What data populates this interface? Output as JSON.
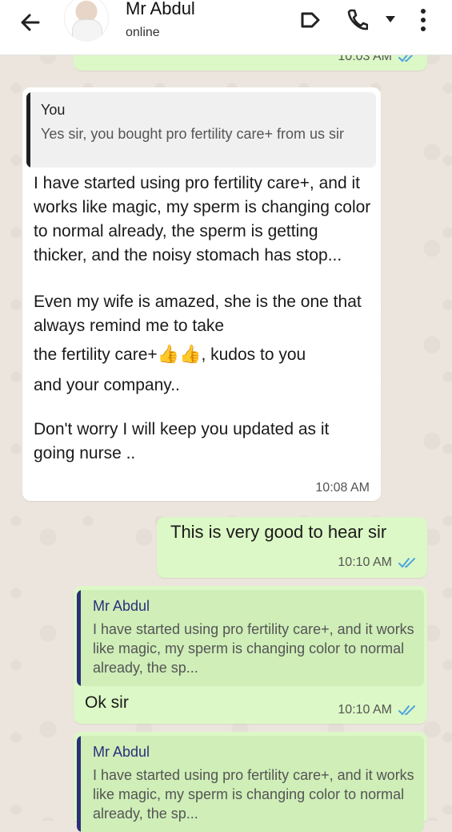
{
  "header": {
    "contact_name": "Mr Abdul",
    "status": "online",
    "icons": [
      "back-arrow-icon",
      "video-call-icon",
      "phone-call-icon",
      "dropdown-icon",
      "more-options-icon"
    ]
  },
  "colors": {
    "incoming_bubble": "#ffffff",
    "outgoing_bubble": "#dcf8c6",
    "read_ticks": "#4fa3e0",
    "quote_own_bar": "#1f1f1f",
    "quote_contact_bar": "#2b2f7a"
  },
  "messages": [
    {
      "direction": "outgoing",
      "time": "10:03 AM",
      "read": true
    },
    {
      "direction": "incoming",
      "quote": {
        "author": "You",
        "text": "Yes sir, you bought pro fertility care+ from us sir"
      },
      "paragraphs": [
        "I have started using pro fertility care+, and it works like magic, my sperm is changing color to normal already, the sperm is getting thicker, and the noisy stomach has stop...",
        "Even my wife is amazed, she is the one that always remind me to take",
        "the fertility care+",
        "👍👍",
        ", kudos to you",
        "and your company..",
        "Don't worry I will keep you updated as it going nurse .."
      ],
      "time": "10:08 AM"
    },
    {
      "direction": "outgoing",
      "text": "This is very good to hear sir",
      "time": "10:10 AM",
      "read": true
    },
    {
      "direction": "outgoing",
      "quote": {
        "author": "Mr Abdul",
        "text": "I have started using pro fertility care+, and it works like magic, my sperm is changing color to normal already, the sp..."
      },
      "text": "Ok sir",
      "time": "10:10 AM",
      "read": true
    },
    {
      "direction": "outgoing",
      "quote": {
        "author": "Mr Abdul",
        "text": "I have started using pro fertility care+, and it works like magic, my sperm is changing color to normal already, the sp..."
      }
    }
  ]
}
